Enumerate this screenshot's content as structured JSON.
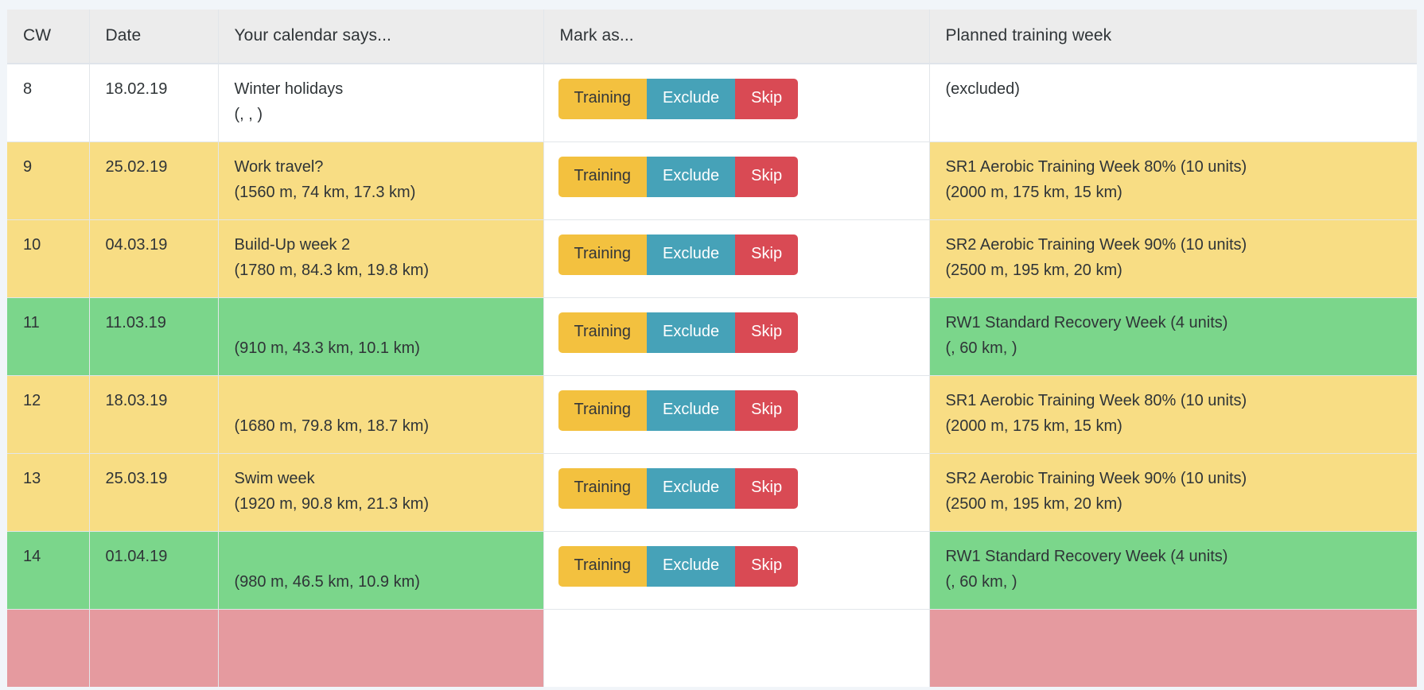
{
  "table": {
    "columns": [
      {
        "key": "cw",
        "label": "CW"
      },
      {
        "key": "date",
        "label": "Date"
      },
      {
        "key": "cal",
        "label": "Your calendar says..."
      },
      {
        "key": "mark",
        "label": "Mark as..."
      },
      {
        "key": "plan",
        "label": "Planned training week"
      }
    ],
    "buttons": {
      "training_label": "Training",
      "exclude_label": "Exclude",
      "skip_label": "Skip"
    },
    "colors": {
      "page_background": "#f1f5f9",
      "header_background": "#ececec",
      "row_yellow": "#f8dd84",
      "row_green": "#7bd68b",
      "row_pink": "#e59a9f",
      "row_white": "#ffffff",
      "button_training": "#f3c13f",
      "button_exclude": "#46a2b8",
      "button_skip": "#d94a54",
      "border": "#e2e6ea",
      "text": "#2f3437"
    },
    "rows": [
      {
        "tint": "plain",
        "cw": "8",
        "date": "18.02.19",
        "calendar_title": "Winter holidays",
        "calendar_stats": "(, , )",
        "plan_title": "(excluded)",
        "plan_stats": ""
      },
      {
        "tint": "yellow",
        "cw": "9",
        "date": "25.02.19",
        "calendar_title": "Work travel?",
        "calendar_stats": "(1560 m, 74 km, 17.3 km)",
        "plan_title": "SR1 Aerobic Training Week 80% (10 units)",
        "plan_stats": "(2000 m, 175 km, 15 km)"
      },
      {
        "tint": "yellow",
        "cw": "10",
        "date": "04.03.19",
        "calendar_title": "Build-Up week 2",
        "calendar_stats": "(1780 m, 84.3 km, 19.8 km)",
        "plan_title": "SR2 Aerobic Training Week 90% (10 units)",
        "plan_stats": "(2500 m, 195 km, 20 km)"
      },
      {
        "tint": "green",
        "cw": "11",
        "date": "11.03.19",
        "calendar_title": "",
        "calendar_stats": "(910 m, 43.3 km, 10.1 km)",
        "plan_title": "RW1 Standard Recovery Week (4 units)",
        "plan_stats": "(, 60 km, )"
      },
      {
        "tint": "yellow",
        "cw": "12",
        "date": "18.03.19",
        "calendar_title": "",
        "calendar_stats": "(1680 m, 79.8 km, 18.7 km)",
        "plan_title": "SR1 Aerobic Training Week 80% (10 units)",
        "plan_stats": "(2000 m, 175 km, 15 km)"
      },
      {
        "tint": "yellow",
        "cw": "13",
        "date": "25.03.19",
        "calendar_title": "Swim week",
        "calendar_stats": "(1920 m, 90.8 km, 21.3 km)",
        "plan_title": "SR2 Aerobic Training Week 90% (10 units)",
        "plan_stats": "(2500 m, 195 km, 20 km)"
      },
      {
        "tint": "green",
        "cw": "14",
        "date": "01.04.19",
        "calendar_title": "",
        "calendar_stats": "(980 m, 46.5 km, 10.9 km)",
        "plan_title": "RW1 Standard Recovery Week (4 units)",
        "plan_stats": "(, 60 km, )"
      },
      {
        "tint": "pink",
        "cw": "",
        "date": "",
        "calendar_title": "",
        "calendar_stats": "",
        "plan_title": "",
        "plan_stats": "",
        "clipped": true
      }
    ]
  }
}
